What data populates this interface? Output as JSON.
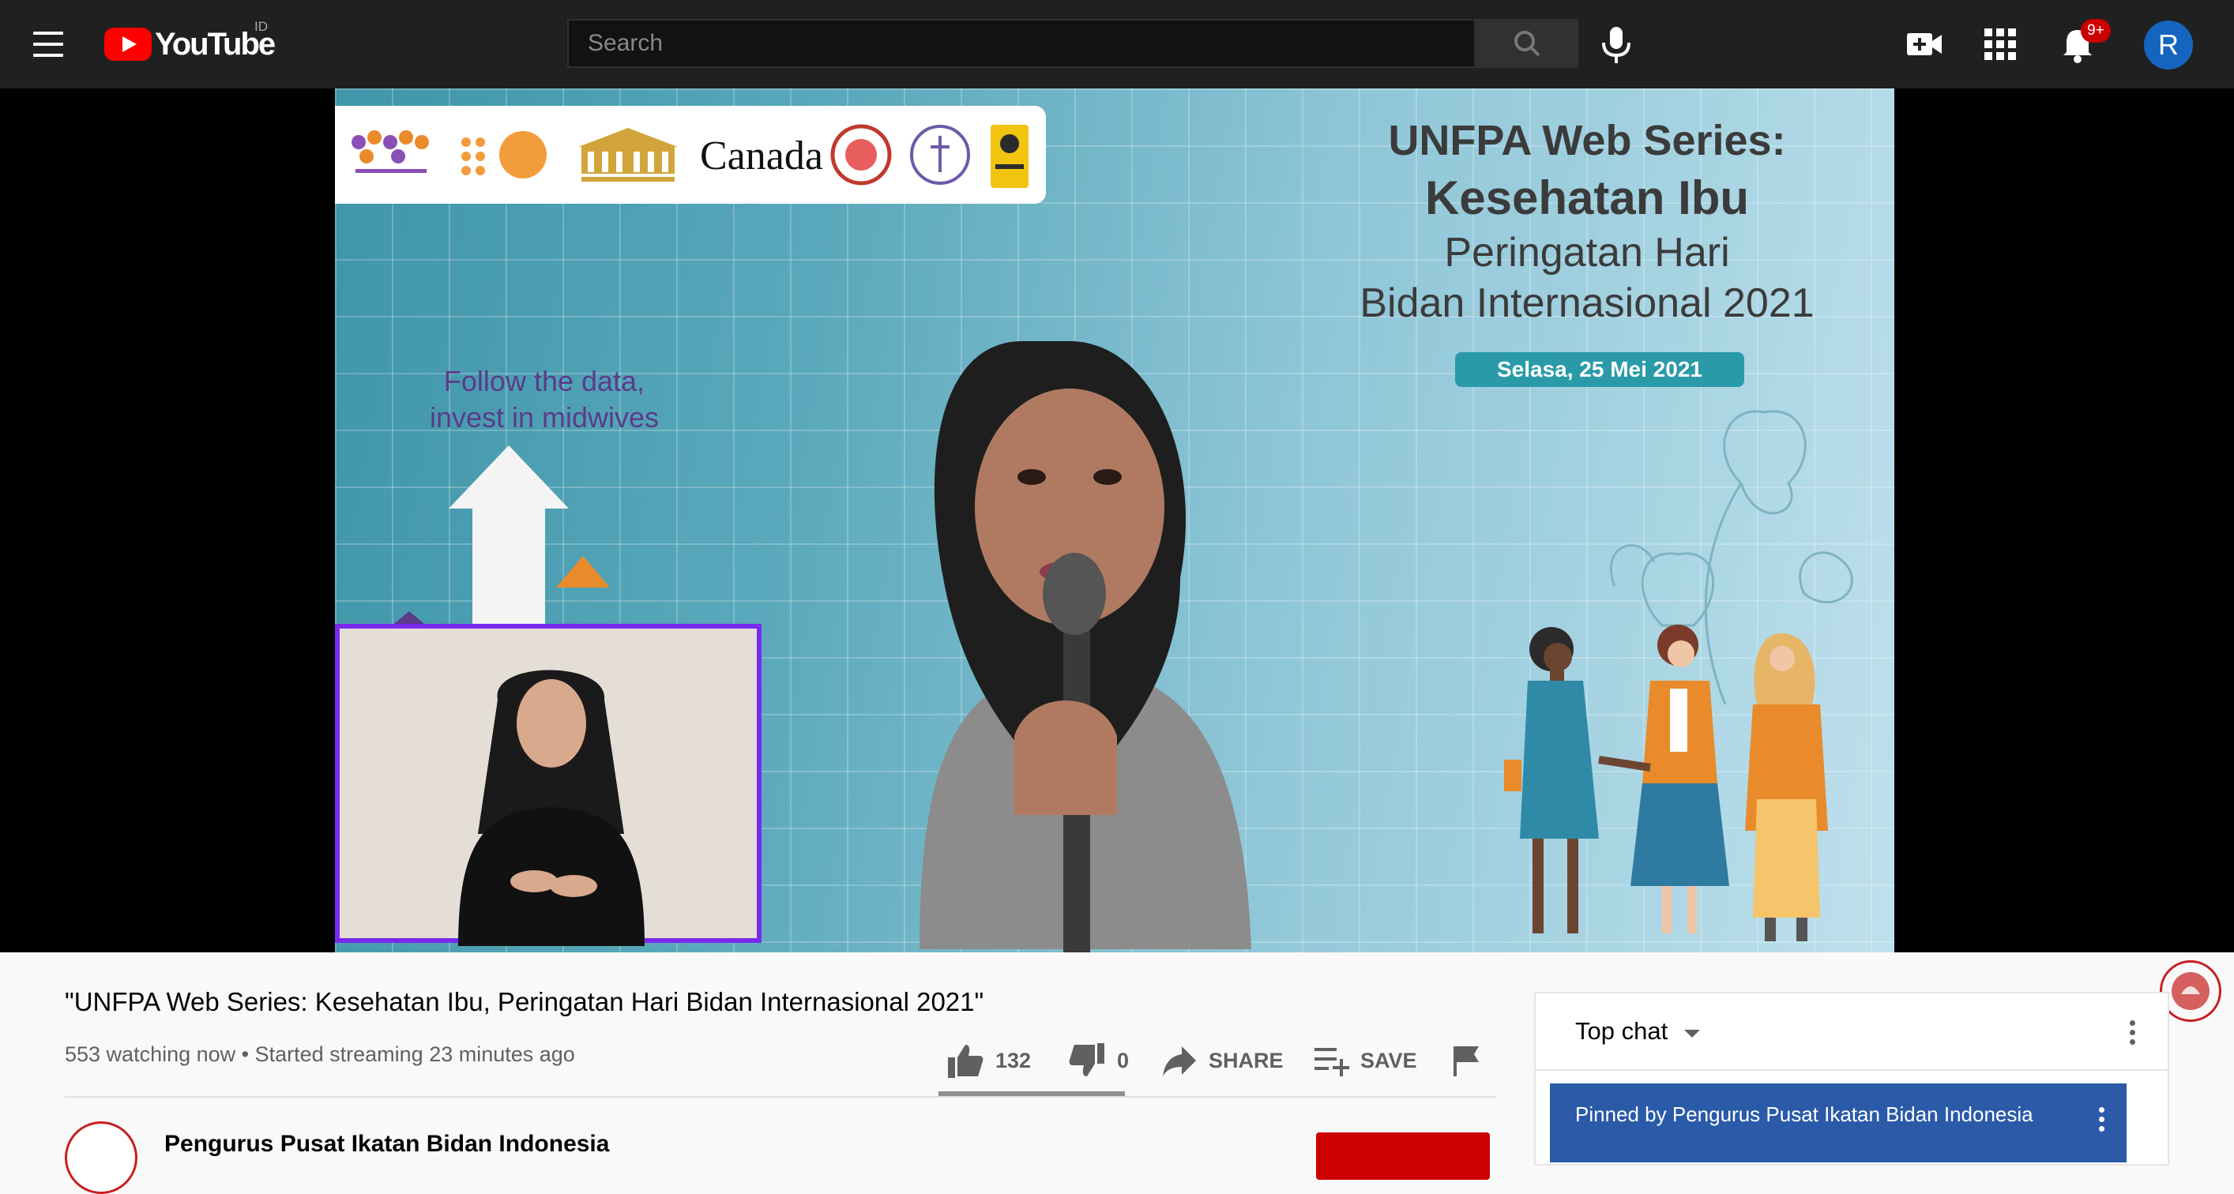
{
  "masthead": {
    "logo_text": "YouTube",
    "region": "ID",
    "search_placeholder": "Search",
    "notifications_badge": "9+",
    "avatar_initial": "R"
  },
  "video": {
    "series_title_line1": "UNFPA Web Series:",
    "series_title_line2": "Kesehatan Ibu",
    "series_title_line3": "Peringatan Hari",
    "series_title_line4": "Bidan Internasional 2021",
    "date": "Selasa, 25 Mei 2021",
    "tagline_line1": "Follow the data,",
    "tagline_line2": "invest in midwives",
    "partner_logo_text": "Canada"
  },
  "info": {
    "title": "\"UNFPA Web Series: Kesehatan Ibu, Peringatan Hari Bidan Internasional 2021\"",
    "meta": "553 watching now • Started streaming 23 minutes ago",
    "likes": "132",
    "dislikes": "0",
    "share_label": "SHARE",
    "save_label": "SAVE",
    "channel_name": "Pengurus Pusat Ikatan Bidan Indonesia"
  },
  "chat": {
    "mode_label": "Top chat",
    "pinned_text": "Pinned by Pengurus Pusat Ikatan Bidan Indonesia"
  },
  "colors": {
    "masthead_bg": "#202020",
    "brand_red": "#ff0000",
    "avatar_blue": "#1565c0",
    "pinned_bg": "#2a5aa8",
    "signer_border": "#7a2af0"
  }
}
